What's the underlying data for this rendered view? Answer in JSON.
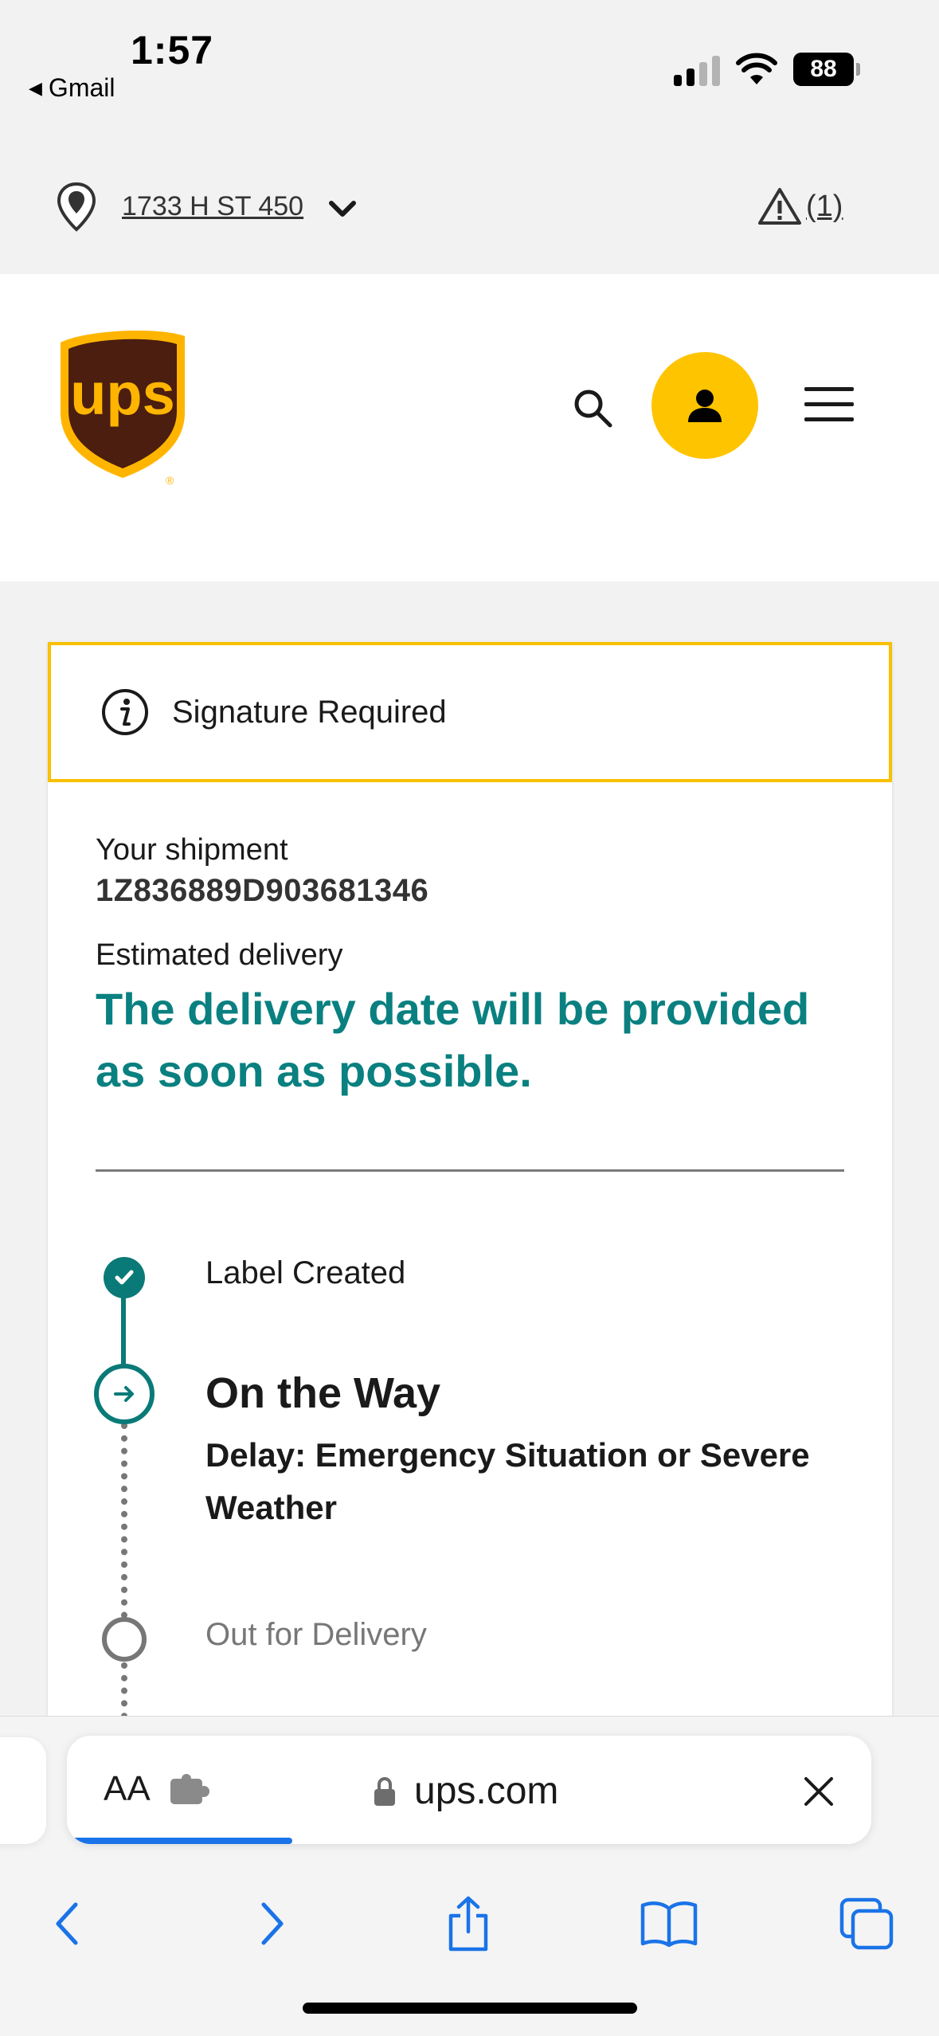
{
  "status_bar": {
    "time": "1:57",
    "back_app": "Gmail",
    "battery": "88"
  },
  "location": {
    "address": "1733 H ST 450",
    "alerts_count": "(1)"
  },
  "header": {
    "logo_text": "ups",
    "brand_color": "#ffc400",
    "logo_shield_color": "#4b1e0f"
  },
  "card": {
    "notice": "Signature Required",
    "shipment_label": "Your shipment",
    "tracking_number": "1Z836889D903681346",
    "estimated_label": "Estimated delivery",
    "estimated_value": "The delivery date will be provided as soon as possible.",
    "accent_color": "#0a8080"
  },
  "timeline": {
    "steps": [
      {
        "label": "Label Created",
        "status": "complete"
      },
      {
        "label": "On the Way",
        "status": "current",
        "detail": "Delay: Emergency Situation or Severe Weather"
      },
      {
        "label": "Out for Delivery",
        "status": "pending"
      }
    ]
  },
  "browser": {
    "text_size_label": "AA",
    "url": "ups.com",
    "load_progress": 0.28,
    "toolbar": [
      "back-icon",
      "forward-icon",
      "share-icon",
      "bookmarks-icon",
      "tabs-icon"
    ]
  }
}
